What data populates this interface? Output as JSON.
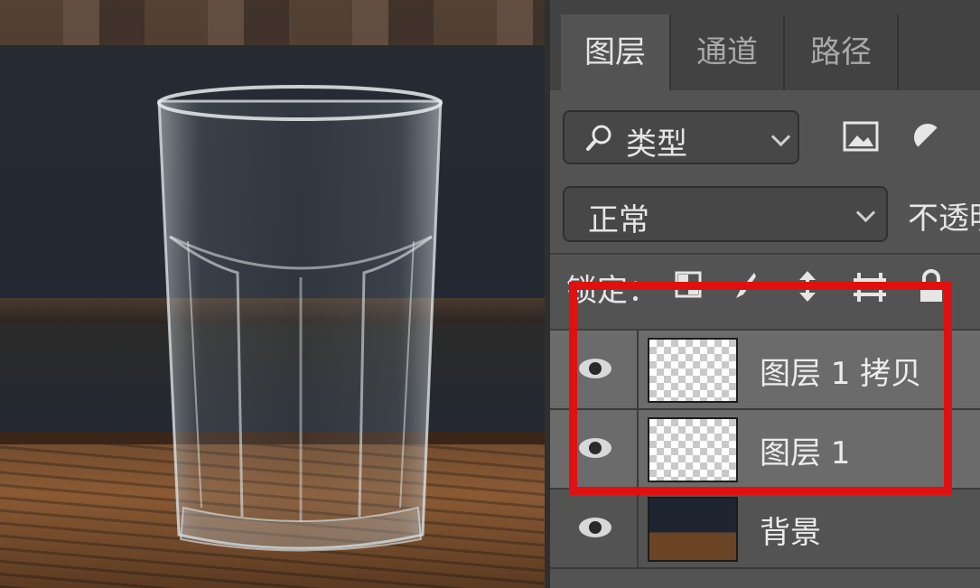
{
  "panel": {
    "tabs": [
      {
        "label": "图层",
        "active": true
      },
      {
        "label": "通道",
        "active": false
      },
      {
        "label": "路径",
        "active": false
      }
    ],
    "filter": {
      "label": "类型",
      "icon": "search-icon"
    },
    "filter_icons": [
      "image-filter-icon",
      "adjustment-filter-icon"
    ],
    "blend_mode": "正常",
    "opacity_label": "不透明",
    "lock_label": "锁定：",
    "layers": [
      {
        "name": "图层 1 拷贝",
        "visible": true,
        "selected": true
      },
      {
        "name": "图层 1",
        "visible": true,
        "selected": true
      },
      {
        "name": "背景",
        "visible": true,
        "selected": false
      }
    ]
  },
  "colors": {
    "panel_bg": "#535353",
    "tab_bar_bg": "#424242",
    "selected_row": "#6b6b6b",
    "highlight": "#e01010"
  }
}
